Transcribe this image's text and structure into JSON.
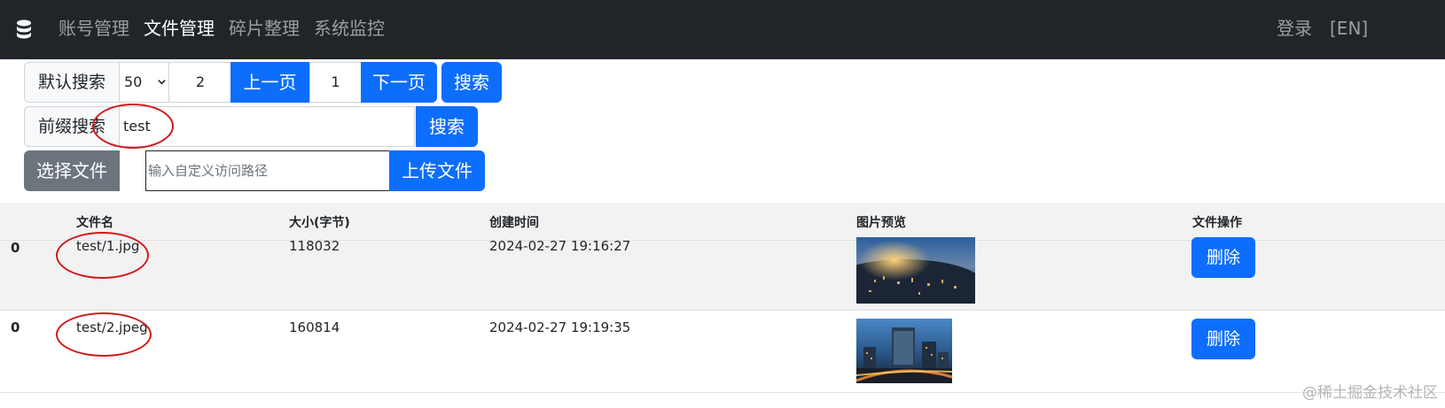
{
  "nav": {
    "brand_icon": "database-icon",
    "items": [
      "账号管理",
      "文件管理",
      "碎片整理",
      "系统监控"
    ],
    "active_index": 1,
    "login": "登录",
    "lang": "[EN]"
  },
  "search": {
    "default_label": "默认搜索",
    "page_size": "50",
    "page_input": "2",
    "prev_label": "上一页",
    "current_page": "1",
    "next_label": "下一页",
    "search_label": "搜索"
  },
  "prefix": {
    "label": "前缀搜索",
    "value": "test",
    "search_label": "搜索"
  },
  "upload": {
    "choose_label": "选择文件",
    "path_placeholder": "输入自定义访问路径",
    "upload_label": "上传文件"
  },
  "table": {
    "headers": [
      "文件名",
      "大小(字节)",
      "创建时间",
      "图片预览",
      "文件操作"
    ],
    "rows": [
      {
        "index": "0",
        "name": "test/1.jpg",
        "size": "118032",
        "created": "2024-02-27 19:16:27",
        "action": "删除"
      },
      {
        "index": "0",
        "name": "test/2.jpeg",
        "size": "160814",
        "created": "2024-02-27 19:19:35",
        "action": "删除"
      }
    ]
  },
  "colors": {
    "primary": "#0d6efd",
    "navbar": "#212529",
    "annotation": "#d0191b"
  },
  "watermark": "@稀土掘金技术社区"
}
